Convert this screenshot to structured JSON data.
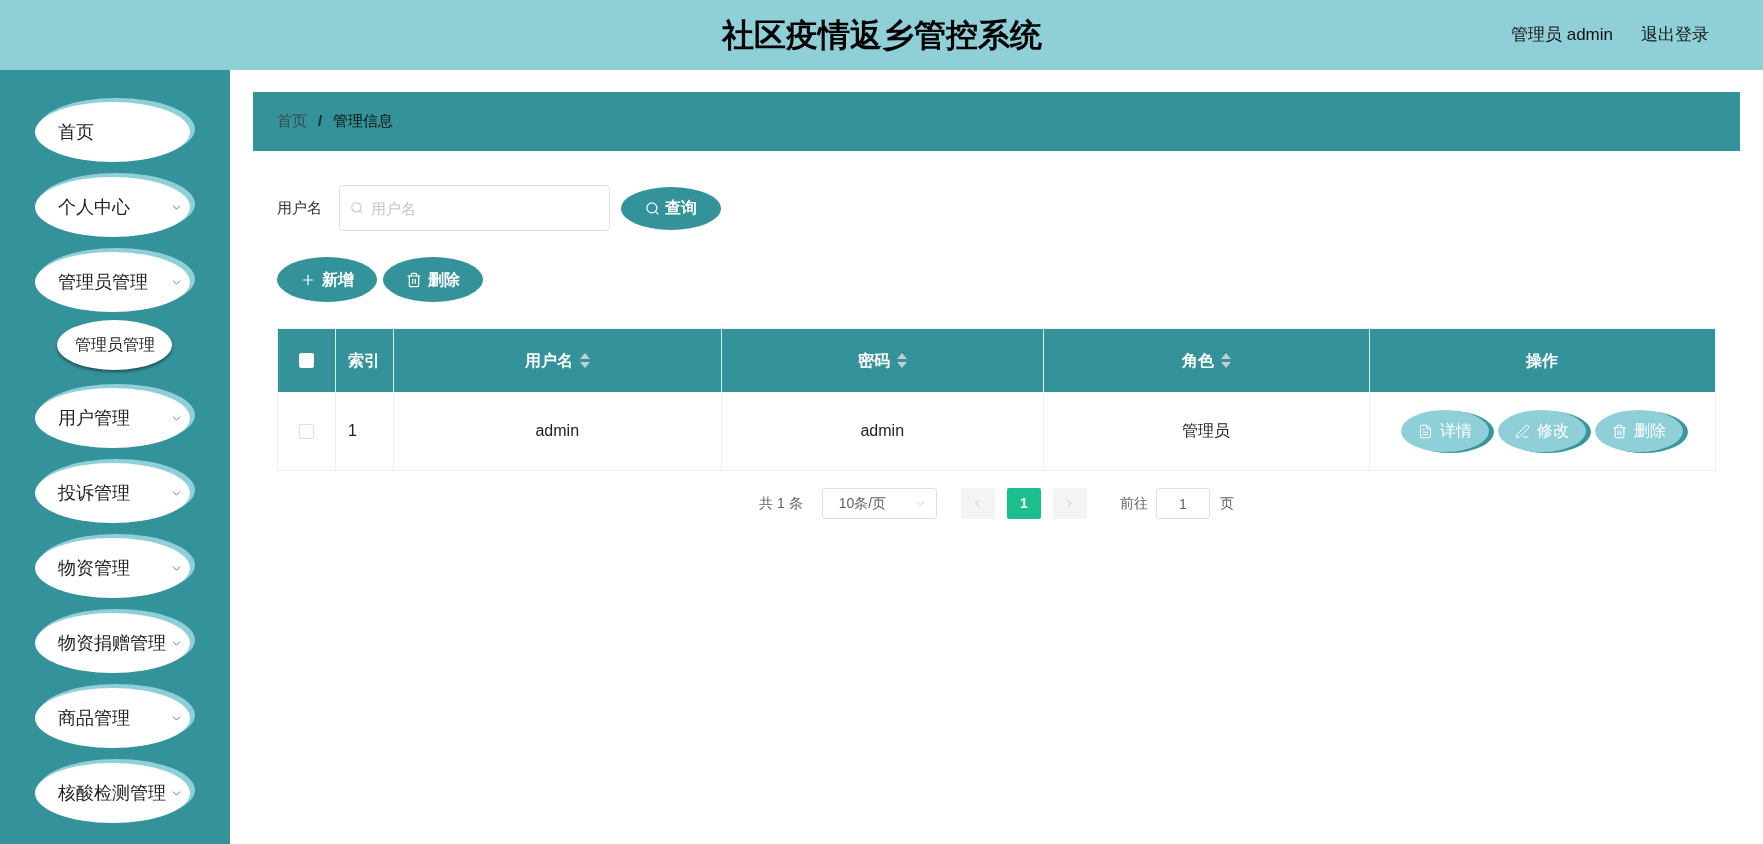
{
  "header": {
    "title": "社区疫情返乡管控系统",
    "user": "管理员 admin",
    "logout": "退出登录"
  },
  "sidebar": {
    "items": [
      {
        "label": "首页",
        "kind": "link"
      },
      {
        "label": "个人中心",
        "kind": "submenu"
      },
      {
        "label": "管理员管理",
        "kind": "submenu",
        "children": [
          {
            "label": "管理员管理"
          }
        ]
      },
      {
        "label": "用户管理",
        "kind": "submenu"
      },
      {
        "label": "投诉管理",
        "kind": "submenu"
      },
      {
        "label": "物资管理",
        "kind": "submenu"
      },
      {
        "label": "物资捐赠管理",
        "kind": "submenu"
      },
      {
        "label": "商品管理",
        "kind": "submenu"
      },
      {
        "label": "核酸检测管理",
        "kind": "submenu"
      }
    ]
  },
  "breadcrumb": {
    "items": [
      {
        "label": "首页",
        "kind": "link"
      },
      {
        "label": "管理信息",
        "kind": "current"
      }
    ],
    "separator": "/"
  },
  "search": {
    "label": "用户名",
    "placeholder": "用户名",
    "button": "查询"
  },
  "toolbar": [
    {
      "label": "新增",
      "kind": "add"
    },
    {
      "label": "删除",
      "kind": "delete"
    }
  ],
  "table": {
    "header_checked": false,
    "columns": [
      {
        "label": "索引",
        "sortable": false
      },
      {
        "label": "用户名",
        "sortable": true
      },
      {
        "label": "密码",
        "sortable": true
      },
      {
        "label": "角色",
        "sortable": true
      },
      {
        "label": "操作",
        "sortable": false
      }
    ],
    "rows": [
      {
        "checked": false,
        "cells": [
          "1",
          "admin",
          "admin",
          "管理员"
        ],
        "actions": [
          {
            "label": "详情",
            "kind": "detail"
          },
          {
            "label": "修改",
            "kind": "edit"
          },
          {
            "label": "删除",
            "kind": "delete"
          }
        ]
      }
    ]
  },
  "pagination": {
    "total": "共 1 条",
    "page_size": "10条/页",
    "prev_disabled": true,
    "next_disabled": true,
    "pages": [
      {
        "label": "1",
        "selected": true
      }
    ],
    "goto_label": "前往",
    "goto_value": "1",
    "goto_suffix": "页"
  }
}
